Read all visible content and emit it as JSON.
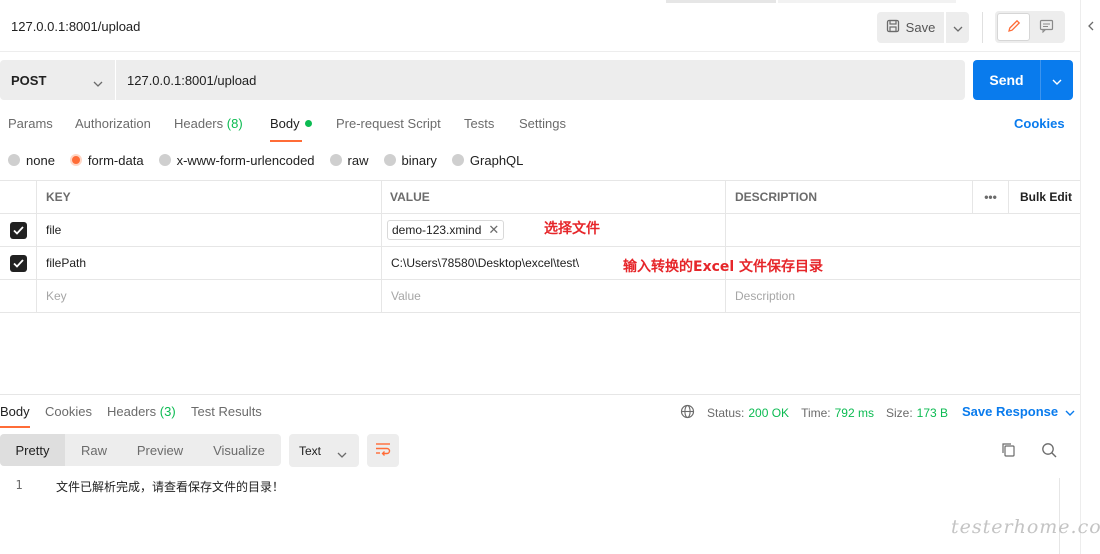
{
  "request": {
    "title": "127.0.0.1:8001/upload",
    "save_label": "Save",
    "method": "POST",
    "url": "127.0.0.1:8001/upload",
    "send_label": "Send"
  },
  "request_tabs": [
    {
      "label": "Params"
    },
    {
      "label": "Authorization"
    },
    {
      "label": "Headers",
      "count": "(8)"
    },
    {
      "label": "Body",
      "active": true
    },
    {
      "label": "Pre-request Script"
    },
    {
      "label": "Tests"
    },
    {
      "label": "Settings"
    }
  ],
  "cookies_label": "Cookies",
  "body_types": [
    {
      "label": "none"
    },
    {
      "label": "form-data",
      "selected": true
    },
    {
      "label": "x-www-form-urlencoded"
    },
    {
      "label": "raw"
    },
    {
      "label": "binary"
    },
    {
      "label": "GraphQL"
    }
  ],
  "params_table": {
    "headers": {
      "key": "KEY",
      "value": "VALUE",
      "description": "DESCRIPTION",
      "more": "•••",
      "bulk_edit": "Bulk Edit"
    },
    "rows": [
      {
        "checked": true,
        "key": "file",
        "value": "demo-123.xmind",
        "value_type": "file",
        "description": ""
      },
      {
        "checked": true,
        "key": "filePath",
        "value": "C:\\Users\\78580\\Desktop\\excel\\test\\",
        "value_type": "text",
        "description": ""
      }
    ],
    "placeholder": {
      "key": "Key",
      "value": "Value",
      "description": "Description"
    }
  },
  "annotations": {
    "file": "选择文件",
    "filePath": "输入转换的Excel 文件保存目录"
  },
  "response": {
    "tabs": [
      {
        "label": "Body",
        "active": true
      },
      {
        "label": "Cookies"
      },
      {
        "label": "Headers",
        "count": "(3)"
      },
      {
        "label": "Test Results"
      }
    ],
    "status_label": "Status:",
    "status_value": "200 OK",
    "time_label": "Time:",
    "time_value": "792 ms",
    "size_label": "Size:",
    "size_value": "173 B",
    "save_response_label": "Save Response",
    "views": [
      "Pretty",
      "Raw",
      "Preview",
      "Visualize"
    ],
    "format": "Text",
    "lines": [
      {
        "no": "1",
        "text": "文件已解析完成，请查看保存文件的目录！"
      }
    ]
  },
  "watermark": "testerhome.com",
  "colors": {
    "accent": "#ff6c37",
    "primary": "#097bed",
    "success": "#0cbb52",
    "annotation": "#e6262a"
  }
}
